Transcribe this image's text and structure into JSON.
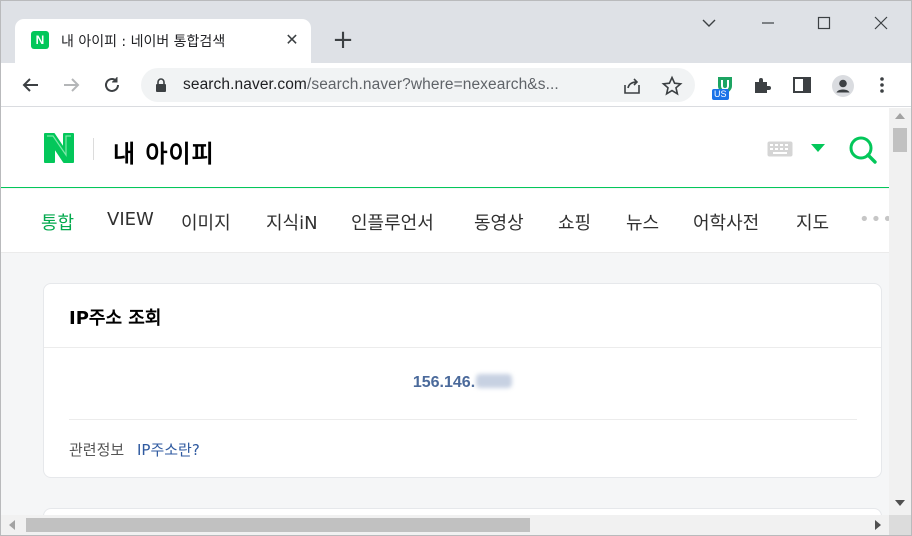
{
  "browser": {
    "tab": {
      "favicon_letter": "N",
      "title": "내 아이피 : 네이버 통합검색",
      "close_glyph": "✕"
    },
    "new_tab_glyph": "+",
    "address": {
      "host": "search.naver.com",
      "path": "/search.naver?where=nexearch&s..."
    },
    "extension_badge": "US",
    "colors": {
      "tabstrip": "#dee1e6",
      "omnibox": "#f1f3f4",
      "accent": "#1a73e8"
    }
  },
  "naver": {
    "query": "내 아이피",
    "brand_color": "#03c75a",
    "tabs": [
      "통합",
      "VIEW",
      "이미지",
      "지식iN",
      "인플루언서",
      "동영상",
      "쇼핑",
      "뉴스",
      "어학사전",
      "지도"
    ],
    "active_tab": "통합",
    "more_glyph": "•••"
  },
  "ip_card": {
    "title": "IP주소 조회",
    "ip_visible": "156.146.",
    "related_label": "관련정보",
    "related_link": "IP주소란?",
    "ip_color": "#4b6a9b"
  }
}
